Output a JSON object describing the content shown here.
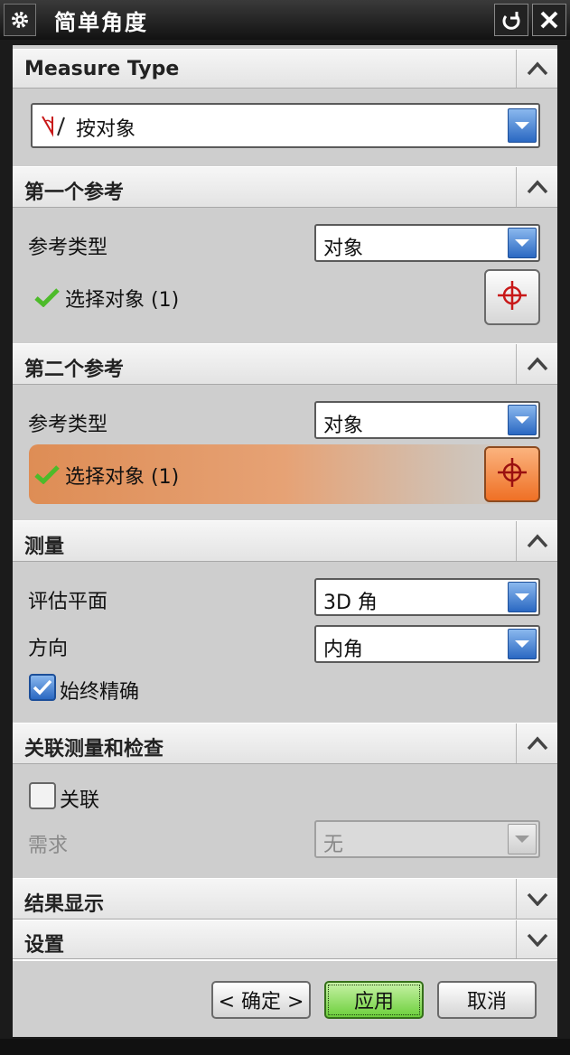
{
  "title_bar": {
    "title": "简单角度",
    "icons": [
      "gear-icon",
      "reset-icon",
      "close-icon"
    ]
  },
  "measure_type": {
    "header": "Measure Type",
    "selected": "按对象",
    "icon": "angle-object-icon"
  },
  "first_reference": {
    "header": "第一个参考",
    "ref_type_label": "参考类型",
    "ref_type_value": "对象",
    "select_label": "选择对象 (1)"
  },
  "second_reference": {
    "header": "第二个参考",
    "ref_type_label": "参考类型",
    "ref_type_value": "对象",
    "select_label": "选择对象 (1)"
  },
  "measurement": {
    "header": "测量",
    "eval_plane_label": "评估平面",
    "eval_plane_value": "3D 角",
    "direction_label": "方向",
    "direction_value": "内角",
    "always_precise_label": "始终精确",
    "always_precise_checked": true
  },
  "associative": {
    "header": "关联测量和检查",
    "associative_label": "关联",
    "associative_checked": false,
    "requirement_label": "需求",
    "requirement_value": "无"
  },
  "results_display": {
    "header": "结果显示"
  },
  "settings": {
    "header": "设置"
  },
  "footer": {
    "ok_label": "< 确定 >",
    "apply_label": "应用",
    "cancel_label": "取消"
  },
  "colors": {
    "accent_blue": "#2a68c2",
    "active_orange": "#ef7025",
    "check_green": "#4dbb2a",
    "apply_green": "#6ccf3b"
  }
}
